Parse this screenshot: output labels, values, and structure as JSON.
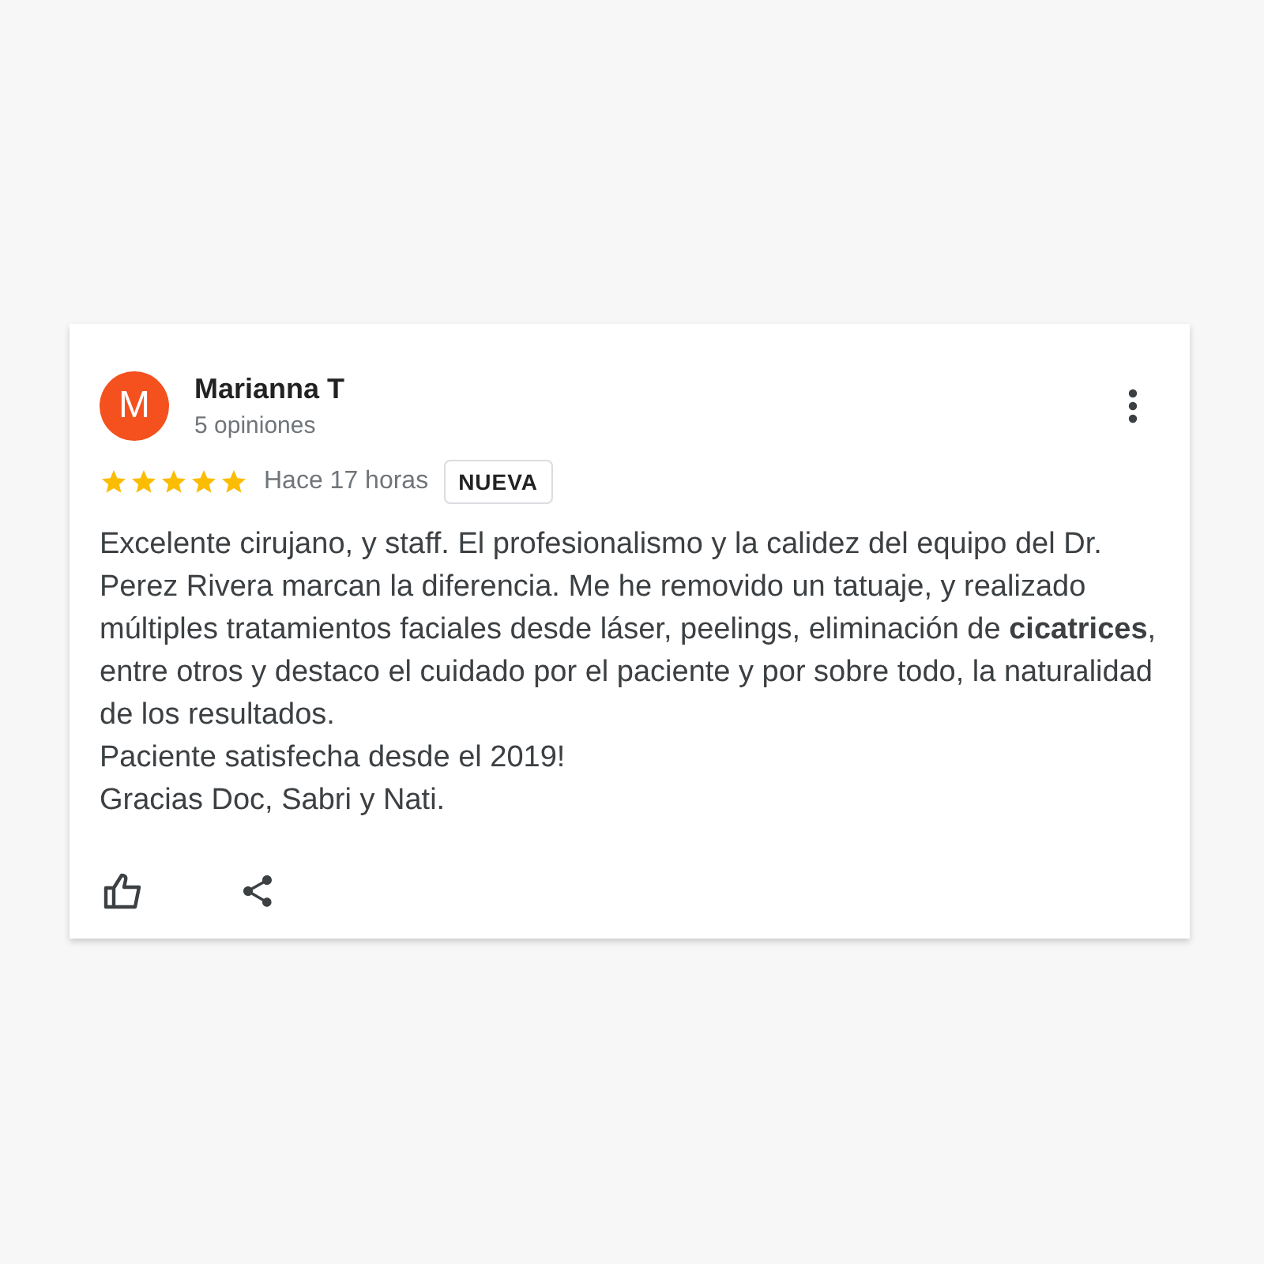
{
  "review": {
    "author": "Marianna T",
    "avatar_letter": "M",
    "review_count": "5 opiniones",
    "stars": 5,
    "time": "Hace 17 horas",
    "badge": "NUEVA",
    "paragraphs": [
      "Excelente cirujano, y staff. El profesionalismo y la calidez del equipo del Dr. Perez Rivera marcan la diferencia. Me he removido un tatuaje, y realizado múltiples tratamientos faciales desde láser, peelings, eliminación de **cicatrices**, entre otros y destaco el cuidado por el paciente y por sobre todo, la naturalidad de los resultados.",
      "Paciente satisfecha desde el 2019!",
      "Gracias Doc, Sabri y Nati."
    ]
  }
}
